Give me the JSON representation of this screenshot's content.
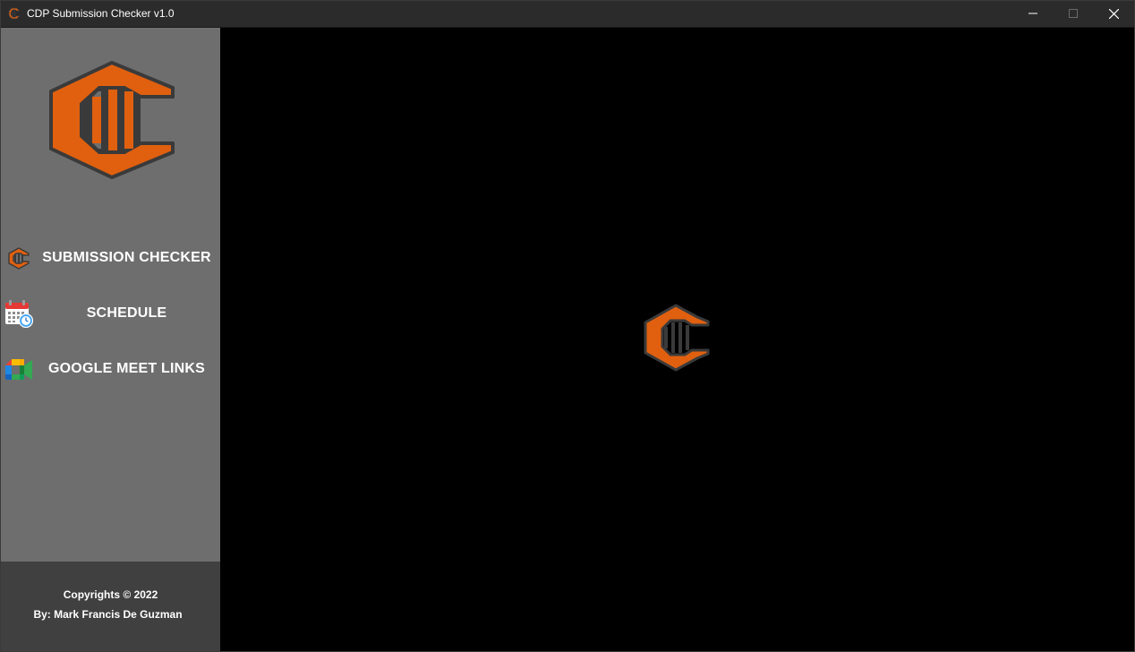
{
  "window": {
    "title": "CDP Submission Checker v1.0",
    "controls": [
      "minimize-icon",
      "maximize-icon",
      "close-icon"
    ]
  },
  "sidebar": {
    "logo_icon": "cdp-logo-icon",
    "items": [
      {
        "label": "SUBMISSION CHECKER",
        "icon": "cdp-logo-icon"
      },
      {
        "label": "SCHEDULE",
        "icon": "calendar-clock-icon"
      },
      {
        "label": "GOOGLE MEET LINKS",
        "icon": "google-meet-icon"
      }
    ]
  },
  "footer": {
    "copyright": "Copyrights © 2022",
    "author": "By: Mark Francis De Guzman"
  },
  "main": {
    "center_icon": "cdp-logo-icon"
  },
  "colors": {
    "titlebar": "#2b2b2b",
    "sidebar": "#6e6e6e",
    "footer": "#404040",
    "main": "#000000",
    "brand_orange": "#e0600f",
    "brand_outline": "#3a3a3a"
  }
}
